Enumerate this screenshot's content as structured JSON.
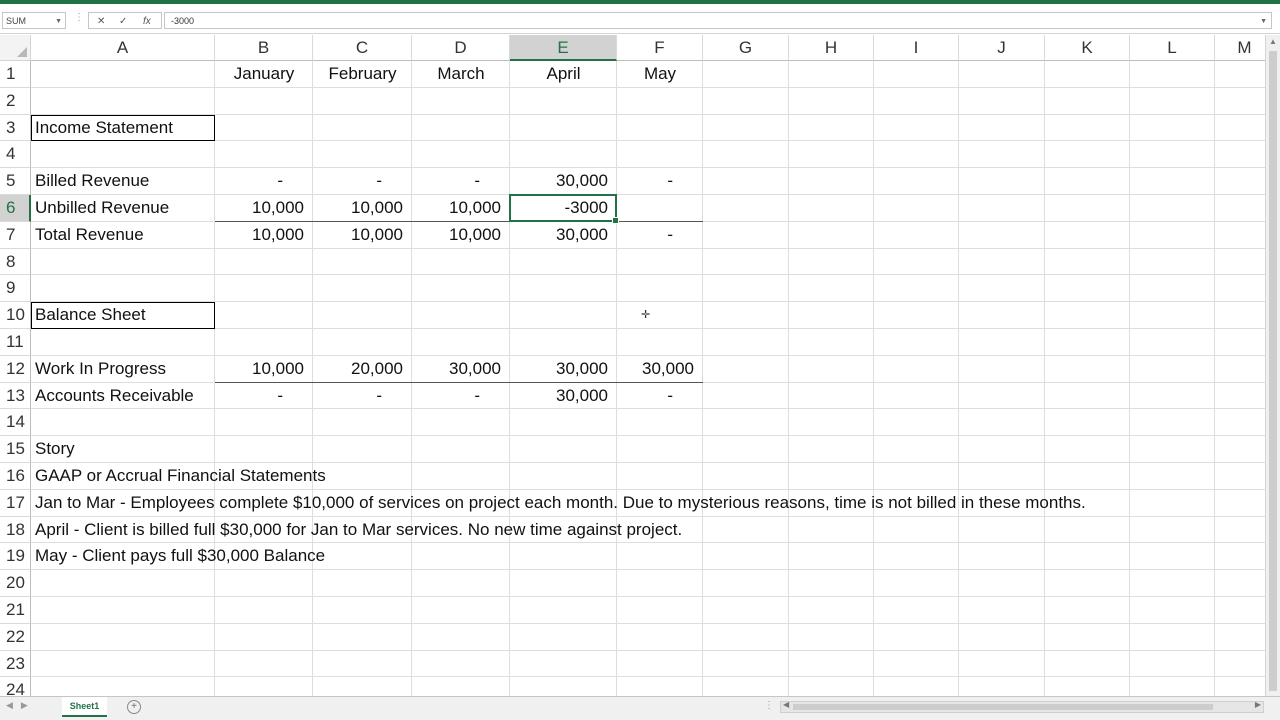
{
  "formula_bar": {
    "name_box": "SUM",
    "cancel_icon": "✕",
    "enter_icon": "✓",
    "function_icon": "fx",
    "content": "-3000"
  },
  "columns": [
    "A",
    "B",
    "C",
    "D",
    "E",
    "F",
    "G",
    "H",
    "I",
    "J",
    "K",
    "L",
    "M"
  ],
  "rows": [
    "1",
    "2",
    "3",
    "4",
    "5",
    "6",
    "7",
    "8",
    "9",
    "10",
    "11",
    "12",
    "13",
    "14",
    "15",
    "16",
    "17",
    "18",
    "19",
    "20",
    "21",
    "22",
    "23",
    "24"
  ],
  "active_cell": "E6",
  "cells": {
    "B1": "January",
    "C1": "February",
    "D1": "March",
    "E1": "April",
    "F1": "May",
    "A3": "Income Statement",
    "A5": "Billed Revenue",
    "B5": "-",
    "C5": "-",
    "D5": "-",
    "E5": "30,000",
    "F5": "-",
    "A6": "Unbilled Revenue",
    "B6": "10,000",
    "C6": "10,000",
    "D6": "10,000",
    "E6": "-3000",
    "A7": "Total Revenue",
    "B7": "10,000",
    "C7": "10,000",
    "D7": "10,000",
    "E7": "30,000",
    "F7": "-",
    "A10": "Balance Sheet",
    "A12": "Work In Progress",
    "B12": "10,000",
    "C12": "20,000",
    "D12": "30,000",
    "E12": "30,000",
    "F12": "30,000",
    "A13": "Accounts Receivable",
    "B13": "-",
    "C13": "-",
    "D13": "-",
    "E13": "30,000",
    "F13": "-",
    "A15": "Story",
    "A16": "GAAP or Accrual Financial Statements",
    "A17": "Jan to Mar - Employees complete $10,000 of services on project each month.  Due to mysterious reasons, time is not billed in these months.",
    "A18": "April - Client is billed full $30,000 for Jan to Mar services.  No new time against project.",
    "A19": "May - Client pays full $30,000 Balance"
  },
  "sheet_tabs": [
    "Sheet1"
  ],
  "colors": {
    "accent": "#217346"
  }
}
